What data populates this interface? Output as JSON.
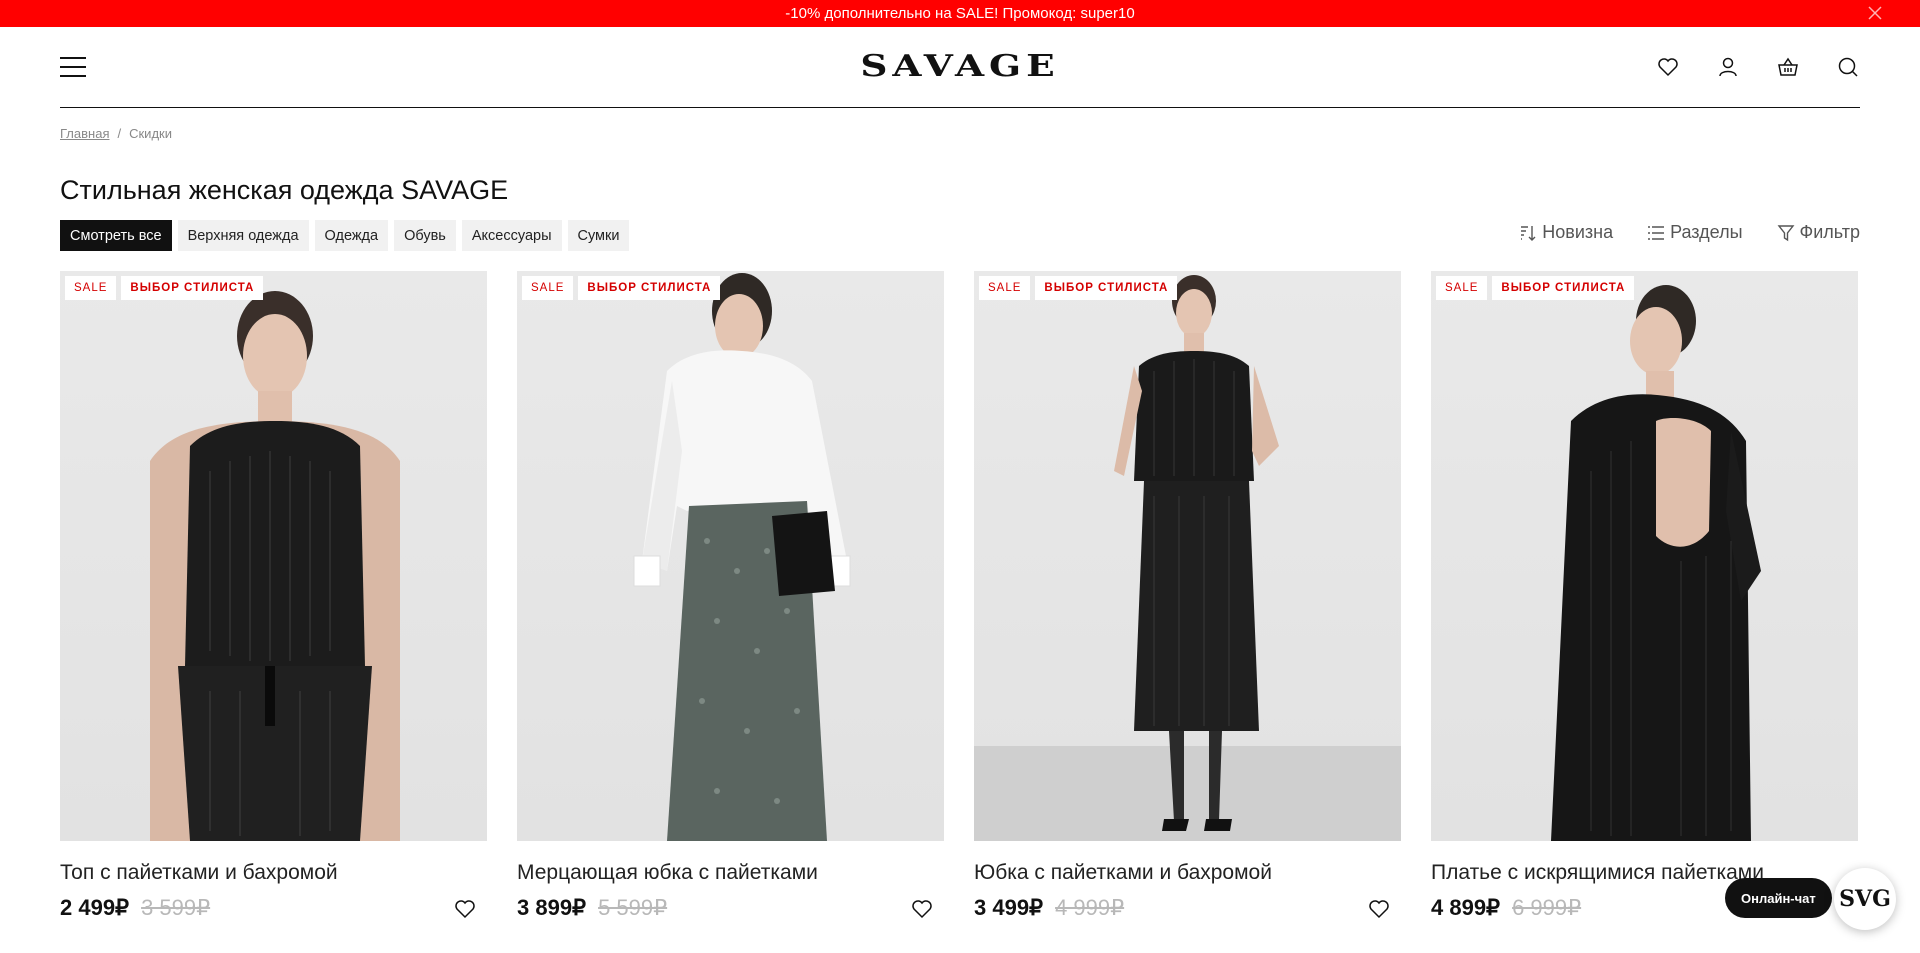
{
  "promo": {
    "text": "-10% дополнительно на SALE! Промокод: super10"
  },
  "header": {
    "logo": "SAVAGE",
    "icons": [
      "heart-icon",
      "user-icon",
      "basket-icon",
      "search-icon"
    ]
  },
  "breadcrumb": {
    "home": "Главная",
    "separator": "/",
    "current": "Скидки"
  },
  "page": {
    "title": "Стильная женская одежда SAVAGE"
  },
  "chips": [
    "Смотреть все",
    "Верхняя одежда",
    "Одежда",
    "Обувь",
    "Аксессуары",
    "Сумки"
  ],
  "tools": {
    "sort": "Новизна",
    "sections": "Разделы",
    "filter": "Фильтр"
  },
  "products": [
    {
      "badge_sale": "SALE",
      "badge_stylist": "ВЫБОР СТИЛИСТА",
      "name": "Топ с пайетками и бахромой",
      "price": "2 499₽",
      "old_price": "3 599₽"
    },
    {
      "badge_sale": "SALE",
      "badge_stylist": "ВЫБОР СТИЛИСТА",
      "name": "Мерцающая юбка с пайетками",
      "price": "3 899₽",
      "old_price": "5 599₽"
    },
    {
      "badge_sale": "SALE",
      "badge_stylist": "ВЫБОР СТИЛИСТА",
      "name": "Юбка с пайетками и бахромой",
      "price": "3 499₽",
      "old_price": "4 999₽"
    },
    {
      "badge_sale": "SALE",
      "badge_stylist": "ВЫБОР СТИЛИСТА",
      "name": "Платье с искрящимися пайетками",
      "price": "4 899₽",
      "old_price": "6 999₽"
    }
  ],
  "chat": {
    "label": "Онлайн-чат",
    "logo": "SVG"
  },
  "colors": {
    "promo": "#ff0000",
    "badge_text": "#d40000",
    "chip_active": "#111111"
  }
}
